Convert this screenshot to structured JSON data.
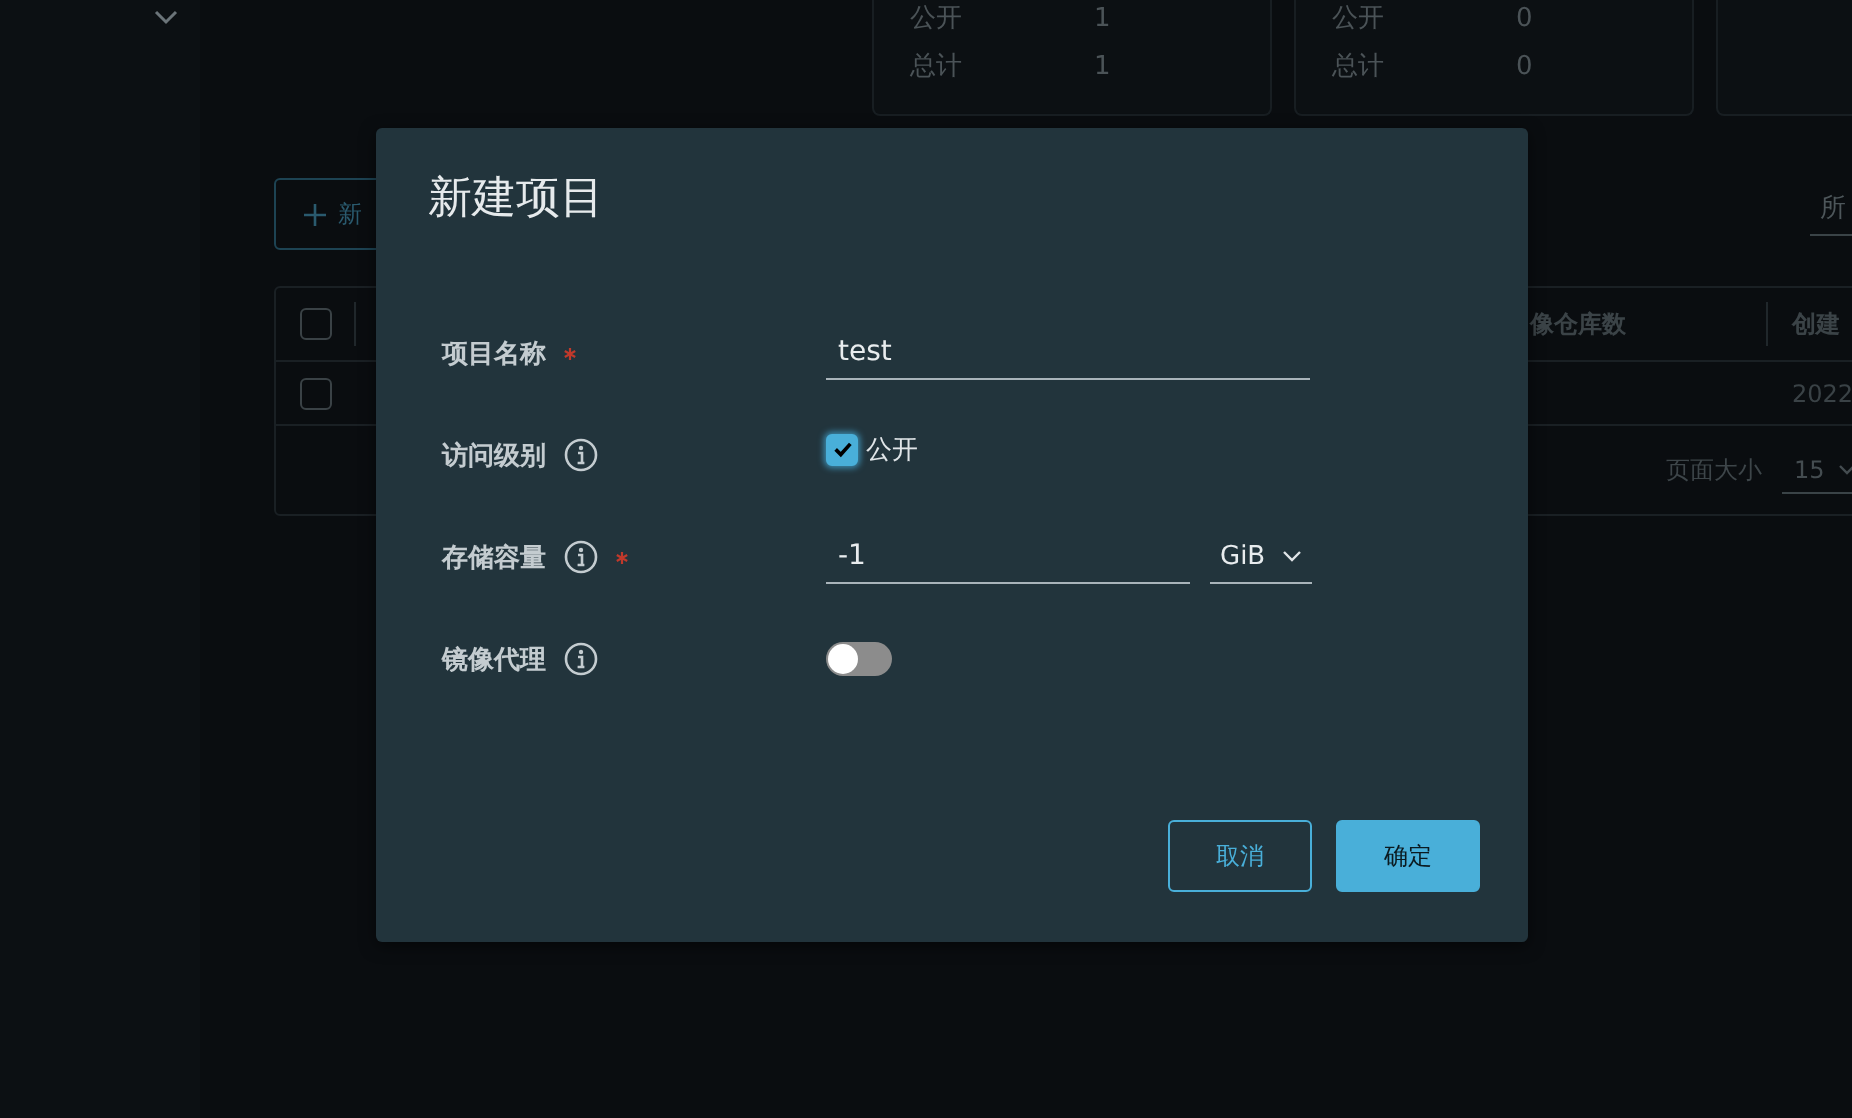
{
  "summary_cards": [
    {
      "rows": [
        {
          "label": "公开",
          "value": "1"
        },
        {
          "label": "总计",
          "value": "1"
        }
      ]
    },
    {
      "rows": [
        {
          "label": "公开",
          "value": "0"
        },
        {
          "label": "总计",
          "value": "0"
        }
      ]
    }
  ],
  "toolbar": {
    "new_button": "新",
    "filter": "所"
  },
  "table": {
    "header_checked": false,
    "columns": [
      {
        "label": "像仓库数"
      },
      {
        "label": "创建"
      }
    ],
    "rows": [
      {
        "checked": false,
        "created": "2022"
      }
    ],
    "footer": {
      "page_size_label": "页面大小",
      "page_size": "15"
    }
  },
  "dialog": {
    "title": "新建项目",
    "fields": [
      {
        "kind": "text",
        "label": "项目名称",
        "required": true,
        "info": false,
        "value": "test"
      },
      {
        "kind": "checkbox",
        "label": "访问级别",
        "required": false,
        "info": true,
        "checked": true,
        "option": "公开"
      },
      {
        "kind": "quota",
        "label": "存储容量",
        "required": true,
        "info": true,
        "value": "-1",
        "unit": "GiB"
      },
      {
        "kind": "toggle",
        "label": "镜像代理",
        "required": false,
        "info": true,
        "on": false
      }
    ],
    "buttons": [
      {
        "kind": "secondary",
        "label": "取消"
      },
      {
        "kind": "primary",
        "label": "确定"
      }
    ]
  }
}
